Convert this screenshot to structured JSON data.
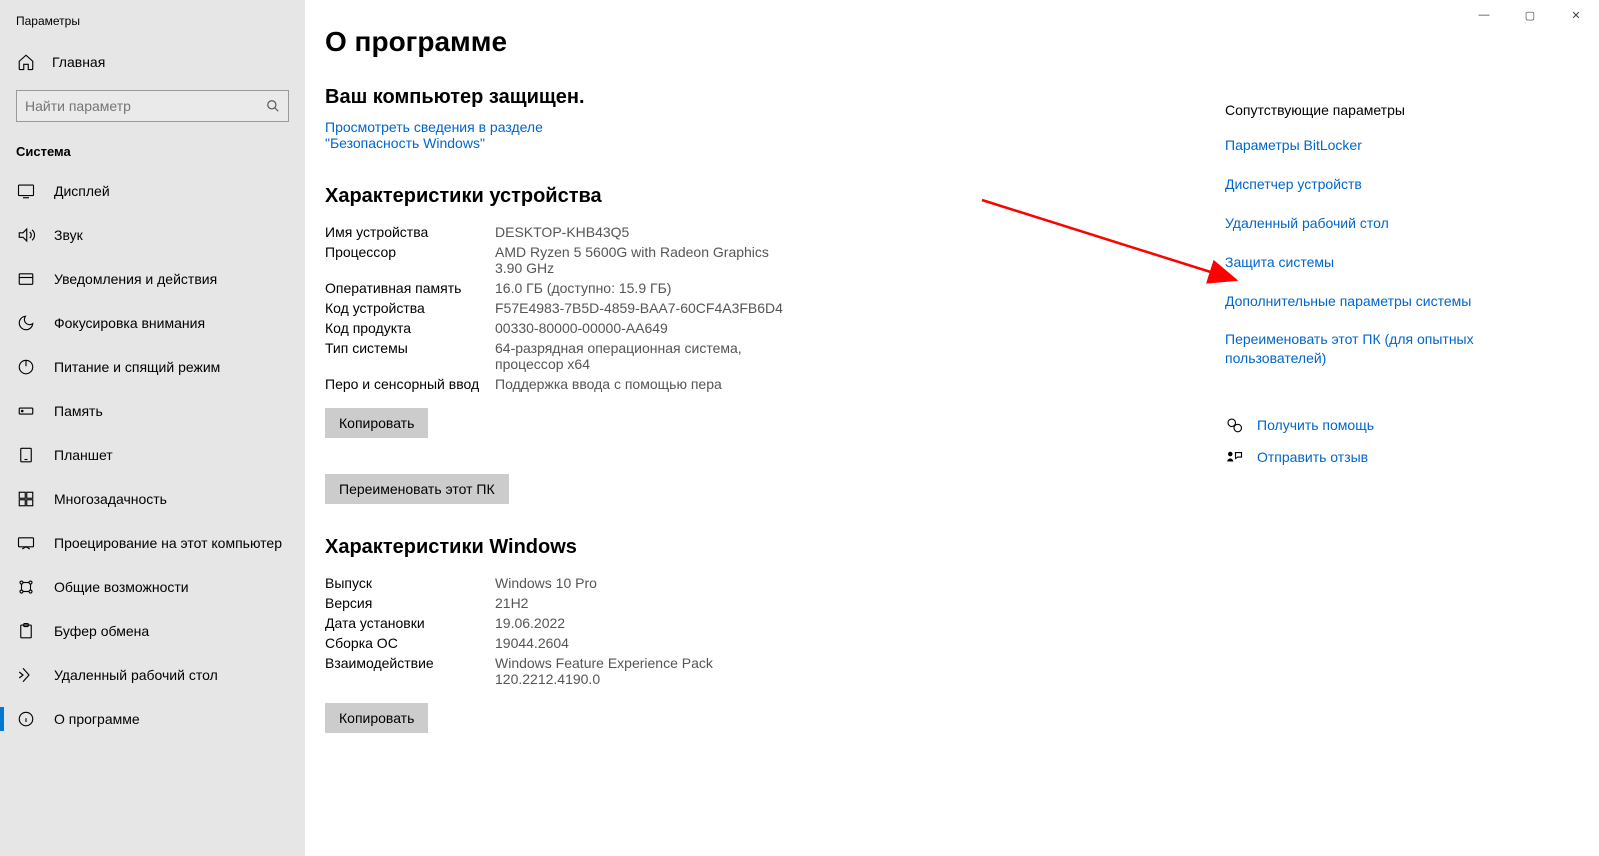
{
  "window": {
    "title": "Параметры"
  },
  "sidebar": {
    "home": "Главная",
    "search_placeholder": "Найти параметр",
    "section": "Система",
    "items": [
      {
        "label": "Дисплей"
      },
      {
        "label": "Звук"
      },
      {
        "label": "Уведомления и действия"
      },
      {
        "label": "Фокусировка внимания"
      },
      {
        "label": "Питание и спящий режим"
      },
      {
        "label": "Память"
      },
      {
        "label": "Планшет"
      },
      {
        "label": "Многозадачность"
      },
      {
        "label": "Проецирование на этот компьютер"
      },
      {
        "label": "Общие возможности"
      },
      {
        "label": "Буфер обмена"
      },
      {
        "label": "Удаленный рабочий стол"
      },
      {
        "label": "О программе"
      }
    ]
  },
  "main": {
    "title": "О программе",
    "protected": "Ваш компьютер защищен.",
    "security_link": "Просмотреть сведения в разделе \"Безопасность Windows\"",
    "device_spec_heading": "Характеристики устройства",
    "device_specs": [
      {
        "label": "Имя устройства",
        "value": "DESKTOP-KHB43Q5"
      },
      {
        "label": "Процессор",
        "value": "AMD Ryzen 5 5600G with Radeon Graphics 3.90 GHz"
      },
      {
        "label": "Оперативная память",
        "value": "16.0 ГБ (доступно: 15.9 ГБ)"
      },
      {
        "label": "Код устройства",
        "value": "F57E4983-7B5D-4859-BAA7-60CF4A3FB6D4"
      },
      {
        "label": "Код продукта",
        "value": "00330-80000-00000-AA649"
      },
      {
        "label": "Тип системы",
        "value": "64-разрядная операционная система, процессор x64"
      },
      {
        "label": "Перо и сенсорный ввод",
        "value": "Поддержка ввода с помощью пера"
      }
    ],
    "copy_button": "Копировать",
    "rename_button": "Переименовать этот ПК",
    "win_spec_heading": "Характеристики Windows",
    "win_specs": [
      {
        "label": "Выпуск",
        "value": "Windows 10 Pro"
      },
      {
        "label": "Версия",
        "value": "21H2"
      },
      {
        "label": "Дата установки",
        "value": "19.06.2022"
      },
      {
        "label": "Сборка ОС",
        "value": "19044.2604"
      },
      {
        "label": "Взаимодействие",
        "value": "Windows Feature Experience Pack 120.2212.4190.0"
      }
    ],
    "copy_button2": "Копировать"
  },
  "right": {
    "heading": "Сопутствующие параметры",
    "links": [
      "Параметры BitLocker",
      "Диспетчер устройств",
      "Удаленный рабочий стол",
      "Защита системы",
      "Дополнительные параметры системы",
      "Переименовать этот ПК (для опытных пользователей)"
    ],
    "help": "Получить помощь",
    "feedback": "Отправить отзыв"
  }
}
